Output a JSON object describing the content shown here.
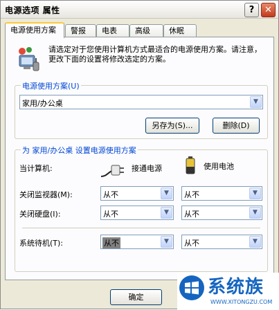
{
  "window": {
    "title": "电源选项 属性",
    "help_label": "?",
    "close_label": "✕"
  },
  "tabs": [
    {
      "label": "电源使用方案",
      "active": true
    },
    {
      "label": "警报"
    },
    {
      "label": "电表"
    },
    {
      "label": "高级"
    },
    {
      "label": "休眠"
    }
  ],
  "intro": {
    "icon": "power-schemes-icon",
    "text": "请选定对于您使用计算机方式最适合的电源使用方案。请注意，更改下面的设置将修改选定的方案。"
  },
  "scheme_group": {
    "legend": "电源使用方案(U)",
    "selected": "家用/办公桌",
    "save_as_label": "另存为(S)...",
    "delete_label": "删除(D)"
  },
  "settings_group": {
    "legend": "为 家用/办公桌 设置电源使用方案",
    "computer_label": "当计算机:",
    "ac_label": "接通电源",
    "ac_icon": "plug-icon",
    "battery_label": "使用电池",
    "battery_icon": "battery-icon",
    "rows": [
      {
        "label": "关闭监视器(M):",
        "ac": "从不",
        "battery": "从不"
      },
      {
        "label": "关闭硬盘(I):",
        "ac": "从不",
        "battery": "从不"
      },
      {
        "label": "系统待机(T):",
        "ac": "从不",
        "battery": "从不"
      }
    ]
  },
  "footer": {
    "ok_label": "确定"
  },
  "watermark": {
    "name": "系统族",
    "url": "WWW.XITONGZU.COM",
    "icon": "windows-logo-icon"
  },
  "colors": {
    "accent": "#0046d5",
    "tab_highlight": "#ffc83c",
    "close_button": "#c2391c"
  }
}
